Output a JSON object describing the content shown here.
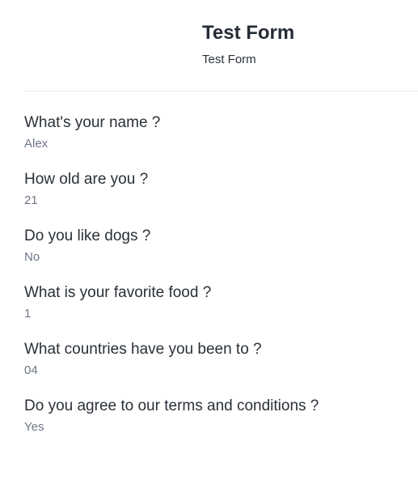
{
  "form": {
    "title": "Test Form",
    "subtitle": "Test Form"
  },
  "responses": [
    {
      "question": "What's your name ?",
      "answer": "Alex"
    },
    {
      "question": "How old are you ?",
      "answer": "21"
    },
    {
      "question": "Do you like dogs ?",
      "answer": "No"
    },
    {
      "question": "What is your favorite food ?",
      "answer": "1"
    },
    {
      "question": "What countries have you been to ?",
      "answer": "04"
    },
    {
      "question": "Do you agree to our terms and conditions ?",
      "answer": "Yes"
    }
  ]
}
